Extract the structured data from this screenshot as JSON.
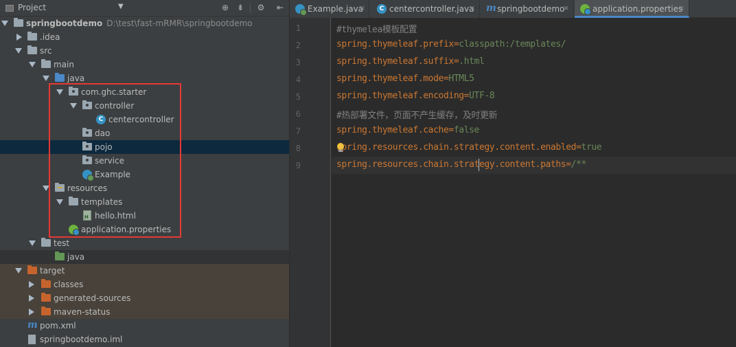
{
  "project_panel": {
    "title": "Project",
    "tree": [
      {
        "label": "springbootdemo",
        "path": "D:\\test\\fast-mRMR\\springbootdemo"
      },
      {
        "label": ".idea"
      },
      {
        "label": "src"
      },
      {
        "label": "main"
      },
      {
        "label": "java"
      },
      {
        "label": "com.ghc.starter"
      },
      {
        "label": "controller"
      },
      {
        "label": "centercontroller"
      },
      {
        "label": "dao"
      },
      {
        "label": "pojo"
      },
      {
        "label": "service"
      },
      {
        "label": "Example"
      },
      {
        "label": "resources"
      },
      {
        "label": "templates"
      },
      {
        "label": "hello.html"
      },
      {
        "label": "application.properties"
      },
      {
        "label": "test"
      },
      {
        "label": "java"
      },
      {
        "label": "target"
      },
      {
        "label": "classes"
      },
      {
        "label": "generated-sources"
      },
      {
        "label": "maven-status"
      },
      {
        "label": "pom.xml"
      },
      {
        "label": "springbootdemo.iml"
      }
    ]
  },
  "editor": {
    "tabs": [
      {
        "label": "Example.java",
        "icon": "class-run-icon"
      },
      {
        "label": "centercontroller.java",
        "icon": "class-icon"
      },
      {
        "label": "springbootdemo",
        "icon": "maven-icon"
      },
      {
        "label": "application.properties",
        "icon": "spring-icon",
        "active": true
      }
    ],
    "line_numbers": [
      "1",
      "2",
      "3",
      "4",
      "5",
      "6",
      "7",
      "8",
      "9"
    ],
    "lines": [
      {
        "comment": "#thymelea模板配置"
      },
      {
        "key": "spring.thymeleaf.prefix",
        "eq": "=",
        "value": "classpath:/templates/"
      },
      {
        "key": "spring.thymeleaf.suffix",
        "eq": "=",
        "value": ".html"
      },
      {
        "key": "spring.thymeleaf.mode",
        "eq": "=",
        "value": "HTML5"
      },
      {
        "key": "spring.thymeleaf.encoding",
        "eq": "=",
        "value": "UTF-8"
      },
      {
        "comment": "#热部署文件，页面不产生缓存，及时更新"
      },
      {
        "key": "spring.thymeleaf.cache",
        "eq": "=",
        "value": "false"
      },
      {
        "key": "spring.resources.chain.strategy.content.enabled",
        "eq": "=",
        "value": "true"
      },
      {
        "key": "spring.resources.chain.strategy.content.paths",
        "eq": "=",
        "value": "/**"
      }
    ]
  },
  "colors": {
    "accent_highlight": "#e53935",
    "property_key": "#cc7832",
    "property_value": "#6a8759",
    "comment": "#808080"
  }
}
